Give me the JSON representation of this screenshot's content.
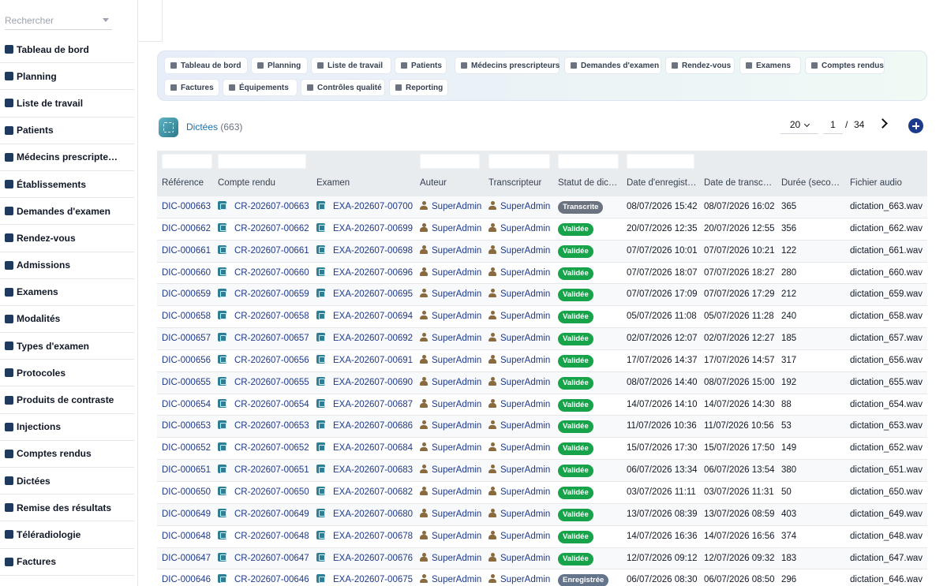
{
  "sidebar": {
    "search_placeholder": "Rechercher",
    "items": [
      {
        "label": "Tableau de bord",
        "icon": "dashboard-icon"
      },
      {
        "label": "Planning",
        "icon": "calendar-icon"
      },
      {
        "label": "Liste de travail",
        "icon": "worklist-icon"
      },
      {
        "label": "Patients",
        "icon": "user-icon"
      },
      {
        "label": "Médecins prescripte…",
        "icon": "doctor-icon"
      },
      {
        "label": "Établissements",
        "icon": "building-icon"
      },
      {
        "label": "Demandes d'examen",
        "icon": "file-plus-icon"
      },
      {
        "label": "Rendez-vous",
        "icon": "calendar-check-icon"
      },
      {
        "label": "Admissions",
        "icon": "id-card-icon"
      },
      {
        "label": "Examens",
        "icon": "worklist-icon"
      },
      {
        "label": "Modalités",
        "icon": "microscope-icon"
      },
      {
        "label": "Types d'examen",
        "icon": "clipboard-icon"
      },
      {
        "label": "Protocoles",
        "icon": "clipboard-list-icon"
      },
      {
        "label": "Produits de contraste",
        "icon": "eyedropper-icon"
      },
      {
        "label": "Injections",
        "icon": "syringe-icon"
      },
      {
        "label": "Comptes rendus",
        "icon": "file-medical-icon"
      },
      {
        "label": "Dictées",
        "icon": "microphone-icon"
      },
      {
        "label": "Remise des résultats",
        "icon": "printer-icon"
      },
      {
        "label": "Téléradiologie",
        "icon": "broadcast-icon"
      },
      {
        "label": "Factures",
        "icon": "invoice-icon"
      }
    ]
  },
  "quick_links": [
    "Tableau de bord",
    "Planning",
    "Liste de travail",
    "Patients",
    "Médecins prescripteurs",
    "Demandes d'examen",
    "Rendez-vous",
    "Examens",
    "Comptes rendus",
    "Factures",
    "Équipements",
    "Contrôles qualité",
    "Reporting"
  ],
  "page": {
    "title": "Dictées",
    "count": "(663)",
    "page_size": "20",
    "current_page": "1",
    "separator": "/",
    "total_pages": "34"
  },
  "table": {
    "columns": [
      "Référence",
      "Compte rendu",
      "Examen",
      "Auteur",
      "Transcripteur",
      "Statut de dic…",
      "Date d'enregist…",
      "Date de transc…",
      "Durée (seco…",
      "Fichier audio"
    ],
    "rows": [
      {
        "ref": "DIC-000663",
        "cr": "CR-202607-00663",
        "ex": "EXA-202607-00700",
        "author": "SuperAdmin",
        "transcriber": "SuperAdmin",
        "status": "Transcrite",
        "recorded": "08/07/2026 15:42",
        "transcribed": "08/07/2026 16:02",
        "duration": "365",
        "file": "dictation_663.wav"
      },
      {
        "ref": "DIC-000662",
        "cr": "CR-202607-00662",
        "ex": "EXA-202607-00699",
        "author": "SuperAdmin",
        "transcriber": "SuperAdmin",
        "status": "Validée",
        "recorded": "20/07/2026 12:35",
        "transcribed": "20/07/2026 12:55",
        "duration": "356",
        "file": "dictation_662.wav"
      },
      {
        "ref": "DIC-000661",
        "cr": "CR-202607-00661",
        "ex": "EXA-202607-00698",
        "author": "SuperAdmin",
        "transcriber": "SuperAdmin",
        "status": "Validée",
        "recorded": "07/07/2026 10:01",
        "transcribed": "07/07/2026 10:21",
        "duration": "122",
        "file": "dictation_661.wav"
      },
      {
        "ref": "DIC-000660",
        "cr": "CR-202607-00660",
        "ex": "EXA-202607-00696",
        "author": "SuperAdmin",
        "transcriber": "SuperAdmin",
        "status": "Validée",
        "recorded": "07/07/2026 18:07",
        "transcribed": "07/07/2026 18:27",
        "duration": "280",
        "file": "dictation_660.wav"
      },
      {
        "ref": "DIC-000659",
        "cr": "CR-202607-00659",
        "ex": "EXA-202607-00695",
        "author": "SuperAdmin",
        "transcriber": "SuperAdmin",
        "status": "Validée",
        "recorded": "07/07/2026 17:09",
        "transcribed": "07/07/2026 17:29",
        "duration": "212",
        "file": "dictation_659.wav"
      },
      {
        "ref": "DIC-000658",
        "cr": "CR-202607-00658",
        "ex": "EXA-202607-00694",
        "author": "SuperAdmin",
        "transcriber": "SuperAdmin",
        "status": "Validée",
        "recorded": "05/07/2026 11:08",
        "transcribed": "05/07/2026 11:28",
        "duration": "240",
        "file": "dictation_658.wav"
      },
      {
        "ref": "DIC-000657",
        "cr": "CR-202607-00657",
        "ex": "EXA-202607-00692",
        "author": "SuperAdmin",
        "transcriber": "SuperAdmin",
        "status": "Validée",
        "recorded": "02/07/2026 12:07",
        "transcribed": "02/07/2026 12:27",
        "duration": "185",
        "file": "dictation_657.wav"
      },
      {
        "ref": "DIC-000656",
        "cr": "CR-202607-00656",
        "ex": "EXA-202607-00691",
        "author": "SuperAdmin",
        "transcriber": "SuperAdmin",
        "status": "Validée",
        "recorded": "17/07/2026 14:37",
        "transcribed": "17/07/2026 14:57",
        "duration": "317",
        "file": "dictation_656.wav"
      },
      {
        "ref": "DIC-000655",
        "cr": "CR-202607-00655",
        "ex": "EXA-202607-00690",
        "author": "SuperAdmin",
        "transcriber": "SuperAdmin",
        "status": "Validée",
        "recorded": "08/07/2026 14:40",
        "transcribed": "08/07/2026 15:00",
        "duration": "192",
        "file": "dictation_655.wav"
      },
      {
        "ref": "DIC-000654",
        "cr": "CR-202607-00654",
        "ex": "EXA-202607-00687",
        "author": "SuperAdmin",
        "transcriber": "SuperAdmin",
        "status": "Validée",
        "recorded": "14/07/2026 14:10",
        "transcribed": "14/07/2026 14:30",
        "duration": "88",
        "file": "dictation_654.wav"
      },
      {
        "ref": "DIC-000653",
        "cr": "CR-202607-00653",
        "ex": "EXA-202607-00686",
        "author": "SuperAdmin",
        "transcriber": "SuperAdmin",
        "status": "Validée",
        "recorded": "11/07/2026 10:36",
        "transcribed": "11/07/2026 10:56",
        "duration": "53",
        "file": "dictation_653.wav"
      },
      {
        "ref": "DIC-000652",
        "cr": "CR-202607-00652",
        "ex": "EXA-202607-00684",
        "author": "SuperAdmin",
        "transcriber": "SuperAdmin",
        "status": "Validée",
        "recorded": "15/07/2026 17:30",
        "transcribed": "15/07/2026 17:50",
        "duration": "149",
        "file": "dictation_652.wav"
      },
      {
        "ref": "DIC-000651",
        "cr": "CR-202607-00651",
        "ex": "EXA-202607-00683",
        "author": "SuperAdmin",
        "transcriber": "SuperAdmin",
        "status": "Validée",
        "recorded": "06/07/2026 13:34",
        "transcribed": "06/07/2026 13:54",
        "duration": "380",
        "file": "dictation_651.wav"
      },
      {
        "ref": "DIC-000650",
        "cr": "CR-202607-00650",
        "ex": "EXA-202607-00682",
        "author": "SuperAdmin",
        "transcriber": "SuperAdmin",
        "status": "Validée",
        "recorded": "03/07/2026 11:11",
        "transcribed": "03/07/2026 11:31",
        "duration": "50",
        "file": "dictation_650.wav"
      },
      {
        "ref": "DIC-000649",
        "cr": "CR-202607-00649",
        "ex": "EXA-202607-00680",
        "author": "SuperAdmin",
        "transcriber": "SuperAdmin",
        "status": "Validée",
        "recorded": "13/07/2026 08:39",
        "transcribed": "13/07/2026 08:59",
        "duration": "403",
        "file": "dictation_649.wav"
      },
      {
        "ref": "DIC-000648",
        "cr": "CR-202607-00648",
        "ex": "EXA-202607-00678",
        "author": "SuperAdmin",
        "transcriber": "SuperAdmin",
        "status": "Validée",
        "recorded": "14/07/2026 16:36",
        "transcribed": "14/07/2026 16:56",
        "duration": "374",
        "file": "dictation_648.wav"
      },
      {
        "ref": "DIC-000647",
        "cr": "CR-202607-00647",
        "ex": "EXA-202607-00676",
        "author": "SuperAdmin",
        "transcriber": "SuperAdmin",
        "status": "Validée",
        "recorded": "12/07/2026 09:12",
        "transcribed": "12/07/2026 09:32",
        "duration": "183",
        "file": "dictation_647.wav"
      },
      {
        "ref": "DIC-000646",
        "cr": "CR-202607-00646",
        "ex": "EXA-202607-00675",
        "author": "SuperAdmin",
        "transcriber": "SuperAdmin",
        "status": "Enregistrée",
        "recorded": "06/07/2026 08:30",
        "transcribed": "06/07/2026 08:50",
        "duration": "296",
        "file": "dictation_646.wav"
      }
    ]
  },
  "status_colors": {
    "Transcrite": "#6b7280",
    "Validée": "#16a34a",
    "Enregistrée": "#64748b"
  },
  "colors": {
    "link": "#1e3a8a",
    "title": "#1e6fa3",
    "add_button": "#1e3a8a"
  }
}
